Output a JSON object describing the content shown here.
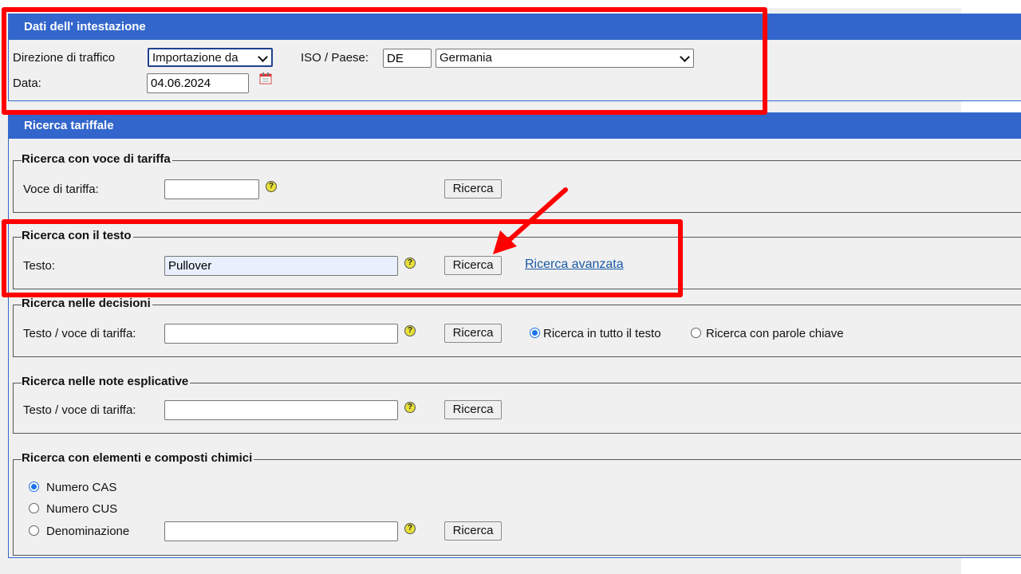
{
  "header_panel": {
    "title": "Dati dell' intestazione",
    "traffic_label": "Direzione di traffico",
    "traffic_value": "Importazione da",
    "iso_label": "ISO / Paese:",
    "iso_code": "DE",
    "country_value": "Germania",
    "date_label": "Data:",
    "date_value": "04.06.2024"
  },
  "search_panel": {
    "title": "Ricerca tariffale",
    "by_tariff": {
      "legend": "Ricerca con voce di tariffa",
      "label": "Voce di tariffa:",
      "value": "",
      "button": "Ricerca"
    },
    "by_text": {
      "legend": "Ricerca con il testo",
      "label": "Testo:",
      "value": "Pullover",
      "button": "Ricerca",
      "advanced_link": "Ricerca avanzata"
    },
    "decisions": {
      "legend": "Ricerca nelle decisioni",
      "label": "Testo / voce di tariffa:",
      "value": "",
      "button": "Ricerca",
      "radio_fulltext": "Ricerca in tutto il testo",
      "radio_keywords": "Ricerca con parole chiave",
      "selected": "fulltext"
    },
    "explanatory_notes": {
      "legend": "Ricerca nelle note esplicative",
      "label": "Testo / voce di tariffa:",
      "value": "",
      "button": "Ricerca"
    },
    "chemicals": {
      "legend": "Ricerca con elementi e composti chimici",
      "radio_cas": "Numero CAS",
      "radio_cus": "Numero CUS",
      "radio_name": "Denominazione",
      "selected": "cas",
      "value": "",
      "button": "Ricerca"
    }
  },
  "help_symbol": "?",
  "colors": {
    "header_blue": "#3366cc",
    "highlight_red": "#ff0000",
    "link_blue": "#1a5aa6"
  }
}
